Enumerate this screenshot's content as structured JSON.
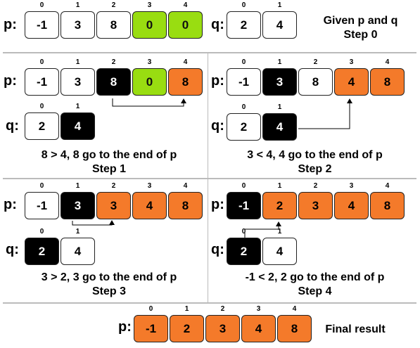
{
  "colors": {
    "white": "#ffffff",
    "green": "#99dd11",
    "orange": "#f47a2a",
    "black": "#000000"
  },
  "panels": [
    {
      "id": "step0",
      "p_label": "p:",
      "p": [
        {
          "index": "0",
          "value": "-1",
          "color": "white"
        },
        {
          "index": "1",
          "value": "3",
          "color": "white"
        },
        {
          "index": "2",
          "value": "8",
          "color": "white"
        },
        {
          "index": "3",
          "value": "0",
          "color": "green"
        },
        {
          "index": "4",
          "value": "0",
          "color": "green"
        }
      ],
      "q_label": "q:",
      "q": [
        {
          "index": "0",
          "value": "2",
          "color": "white"
        },
        {
          "index": "1",
          "value": "4",
          "color": "white"
        }
      ],
      "caption_line1": "Given p and q",
      "caption_line2": "Step 0"
    },
    {
      "id": "step1",
      "p_label": "p:",
      "p": [
        {
          "index": "0",
          "value": "-1",
          "color": "white"
        },
        {
          "index": "1",
          "value": "3",
          "color": "white"
        },
        {
          "index": "2",
          "value": "8",
          "color": "black"
        },
        {
          "index": "3",
          "value": "0",
          "color": "green"
        },
        {
          "index": "4",
          "value": "8",
          "color": "orange"
        }
      ],
      "q_label": "q:",
      "q": [
        {
          "index": "0",
          "value": "2",
          "color": "white"
        },
        {
          "index": "1",
          "value": "4",
          "color": "black"
        }
      ],
      "caption_line1": "8 > 4, 8 go to the end of p",
      "caption_line2": "Step 1"
    },
    {
      "id": "step2",
      "p_label": "p:",
      "p": [
        {
          "index": "0",
          "value": "-1",
          "color": "white"
        },
        {
          "index": "1",
          "value": "3",
          "color": "black"
        },
        {
          "index": "2",
          "value": "8",
          "color": "white"
        },
        {
          "index": "3",
          "value": "4",
          "color": "orange"
        },
        {
          "index": "4",
          "value": "8",
          "color": "orange"
        }
      ],
      "q_label": "q:",
      "q": [
        {
          "index": "0",
          "value": "2",
          "color": "white"
        },
        {
          "index": "1",
          "value": "4",
          "color": "black"
        }
      ],
      "caption_line1": "3 < 4, 4 go to the end of p",
      "caption_line2": "Step 2"
    },
    {
      "id": "step3",
      "p_label": "p:",
      "p": [
        {
          "index": "0",
          "value": "-1",
          "color": "white"
        },
        {
          "index": "1",
          "value": "3",
          "color": "black"
        },
        {
          "index": "2",
          "value": "3",
          "color": "orange"
        },
        {
          "index": "3",
          "value": "4",
          "color": "orange"
        },
        {
          "index": "4",
          "value": "8",
          "color": "orange"
        }
      ],
      "q_label": "q:",
      "q": [
        {
          "index": "0",
          "value": "2",
          "color": "black"
        },
        {
          "index": "1",
          "value": "4",
          "color": "white"
        }
      ],
      "caption_line1": "3 > 2, 3 go to the end of p",
      "caption_line2": "Step 3"
    },
    {
      "id": "step4",
      "p_label": "p:",
      "p": [
        {
          "index": "0",
          "value": "-1",
          "color": "black"
        },
        {
          "index": "1",
          "value": "2",
          "color": "orange"
        },
        {
          "index": "2",
          "value": "3",
          "color": "orange"
        },
        {
          "index": "3",
          "value": "4",
          "color": "orange"
        },
        {
          "index": "4",
          "value": "8",
          "color": "orange"
        }
      ],
      "q_label": "q:",
      "q": [
        {
          "index": "0",
          "value": "2",
          "color": "black"
        },
        {
          "index": "1",
          "value": "4",
          "color": "white"
        }
      ],
      "caption_line1": "-1 < 2, 2 go to the end of p",
      "caption_line2": "Step 4"
    },
    {
      "id": "final",
      "p_label": "p:",
      "p": [
        {
          "index": "0",
          "value": "-1",
          "color": "orange"
        },
        {
          "index": "1",
          "value": "2",
          "color": "orange"
        },
        {
          "index": "2",
          "value": "3",
          "color": "orange"
        },
        {
          "index": "3",
          "value": "4",
          "color": "orange"
        },
        {
          "index": "4",
          "value": "8",
          "color": "orange"
        }
      ],
      "caption_line1": "Final result"
    }
  ]
}
